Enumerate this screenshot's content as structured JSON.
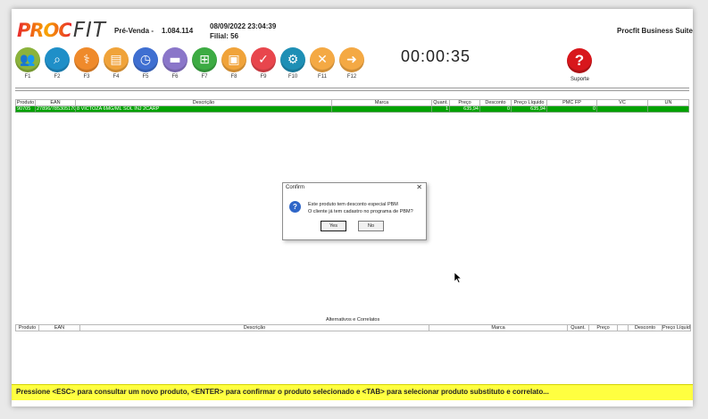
{
  "header": {
    "logo_proc": "PROC",
    "logo_fit": "FIT",
    "module": "Pré-Venda -",
    "version": "1.084.114",
    "datetime": "08/09/2022 23:04:39",
    "branch": "Filial: 56",
    "suite": "Procfit Business Suite",
    "timer": "00:00:35",
    "support_label": "Suporte"
  },
  "toolbar": [
    {
      "key": "F1",
      "icon": "people-icon",
      "color": "#8bb33c"
    },
    {
      "key": "F2",
      "icon": "search-icon",
      "color": "#1f8fc8"
    },
    {
      "key": "F3",
      "icon": "caduceus-icon",
      "color": "#ef8a2b"
    },
    {
      "key": "F4",
      "icon": "id-card-icon",
      "color": "#f0a33a"
    },
    {
      "key": "F5",
      "icon": "clock-icon",
      "color": "#3f6fd1"
    },
    {
      "key": "F6",
      "icon": "truck-icon",
      "color": "#8a76c9"
    },
    {
      "key": "F7",
      "icon": "cart-icon",
      "color": "#3dab43"
    },
    {
      "key": "F8",
      "icon": "document-icon",
      "color": "#f0a33a"
    },
    {
      "key": "F9",
      "icon": "check-icon",
      "color": "#e8464d"
    },
    {
      "key": "F10",
      "icon": "gears-icon",
      "color": "#1e8fb5"
    },
    {
      "key": "F11",
      "icon": "cancel-icon",
      "color": "#f4a944"
    },
    {
      "key": "F12",
      "icon": "arrow-right-icon",
      "color": "#f4a944"
    }
  ],
  "products_table": {
    "columns": [
      "Produto",
      "EAN",
      "Descrição",
      "Marca",
      "Quant.",
      "Preço",
      "Desconto",
      "Preço Líquido",
      "PMC FP",
      "VC",
      "UN"
    ],
    "rows": [
      [
        "90705",
        "27896/785305170",
        "8 VICTOZA 6MG/ML SOL INJ 2CARP",
        "",
        "1",
        "635,94",
        "0",
        "635,94",
        "0",
        "",
        ""
      ]
    ]
  },
  "dialog": {
    "title": "Confirm",
    "close": "✕",
    "line1": "Este produto tem desconto especial PBM",
    "line2": "O cliente já tem cadastro no programa de PBM?",
    "yes": "Yes",
    "no": "No"
  },
  "alternatives": {
    "title": "Alternativos e Correlatos",
    "columns": [
      "Produto",
      "EAN",
      "Descrição",
      "Marca",
      "Quant.",
      "Preço",
      "",
      "Desconto",
      "Preço Líquido"
    ]
  },
  "status_bar": "Pressione <ESC> para consultar um novo produto, <ENTER> para confirmar o produto selecionado e <TAB> para selecionar produto substituto e correlato..."
}
